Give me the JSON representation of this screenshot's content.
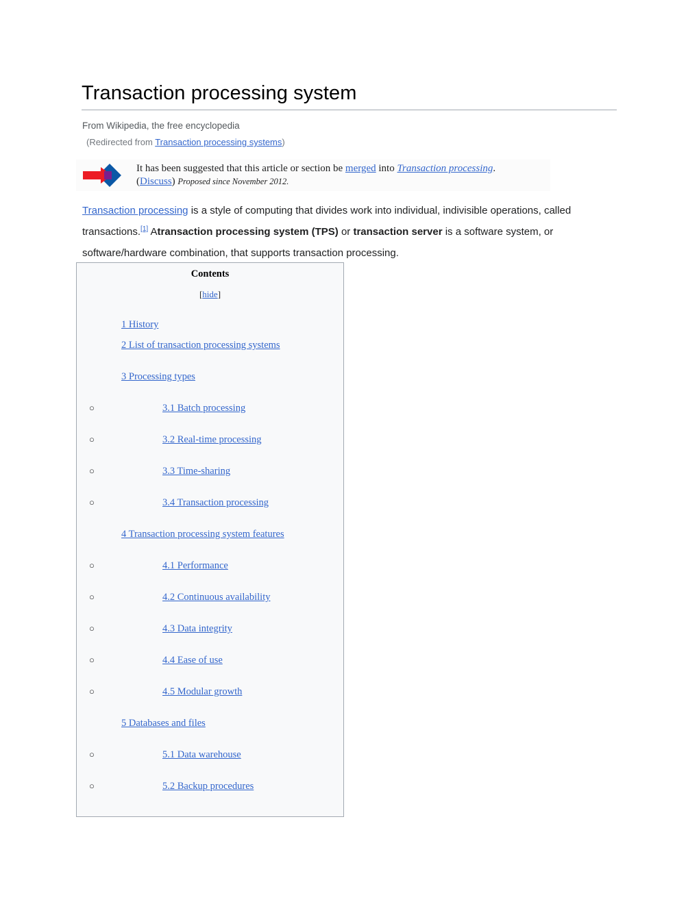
{
  "article": {
    "title": "Transaction processing system",
    "subtitle": "From Wikipedia, the free encyclopedia",
    "redirect": {
      "prefix": "(Redirected from ",
      "link": "Transaction processing systems",
      "suffix": ")"
    }
  },
  "merge_notice": {
    "icon": "merge-arrow-icon",
    "line1_part1": "It has been suggested that this article or section be ",
    "line1_link1": "merged",
    "line1_part2": " into ",
    "line1_link2": "Transaction processing",
    "line1_part3": ".",
    "line2_open": "(",
    "line2_link": "Discuss",
    "line2_close": ") ",
    "line2_proposed": "Proposed since November 2012."
  },
  "lead": {
    "link1": "Transaction processing",
    "text1": " is a style of computing that divides work into individual, indivisible operations, called transactions.",
    "ref1": "[1]",
    "text2": " A",
    "bold1": "transaction processing system (TPS)",
    "text3": " or ",
    "bold2": "transaction server",
    "text4": " is a software system, or software/hardware combination, that supports transaction processing."
  },
  "toc": {
    "heading": "Contents",
    "toggle_open": "[",
    "toggle_label": "hide",
    "toggle_close": "]",
    "items": [
      {
        "level": 1,
        "label": "1 History",
        "gap": false
      },
      {
        "level": 1,
        "label": "2 List of transaction processing systems",
        "gap": false
      },
      {
        "level": 1,
        "label": "3 Processing types",
        "gap": true
      },
      {
        "level": 2,
        "label": "3.1 Batch processing",
        "gap": true
      },
      {
        "level": 2,
        "label": "3.2 Real-time processing",
        "gap": true
      },
      {
        "level": 2,
        "label": "3.3 Time-sharing",
        "gap": true
      },
      {
        "level": 2,
        "label": "3.4 Transaction processing",
        "gap": true
      },
      {
        "level": 1,
        "label": "4 Transaction processing system features",
        "gap": true
      },
      {
        "level": 2,
        "label": "4.1 Performance",
        "gap": true
      },
      {
        "level": 2,
        "label": "4.2 Continuous availability",
        "gap": true
      },
      {
        "level": 2,
        "label": "4.3 Data integrity",
        "gap": true
      },
      {
        "level": 2,
        "label": "4.4 Ease of use",
        "gap": true
      },
      {
        "level": 2,
        "label": "4.5 Modular growth",
        "gap": true
      },
      {
        "level": 1,
        "label": "5 Databases and files",
        "gap": true
      },
      {
        "level": 2,
        "label": "5.1 Data warehouse",
        "gap": true
      },
      {
        "level": 2,
        "label": "5.2 Backup procedures",
        "gap": true
      }
    ],
    "bullet_glyph": "○"
  },
  "colors": {
    "link": "#3366cc",
    "text": "#202122",
    "muted": "#72777d",
    "toc_bg": "#f8f9fa",
    "toc_border": "#a2a9b1",
    "merge_bg": "#fbfbfb",
    "arrow_red": "#ec1c24",
    "diamond_blue": "#0b58a6"
  }
}
